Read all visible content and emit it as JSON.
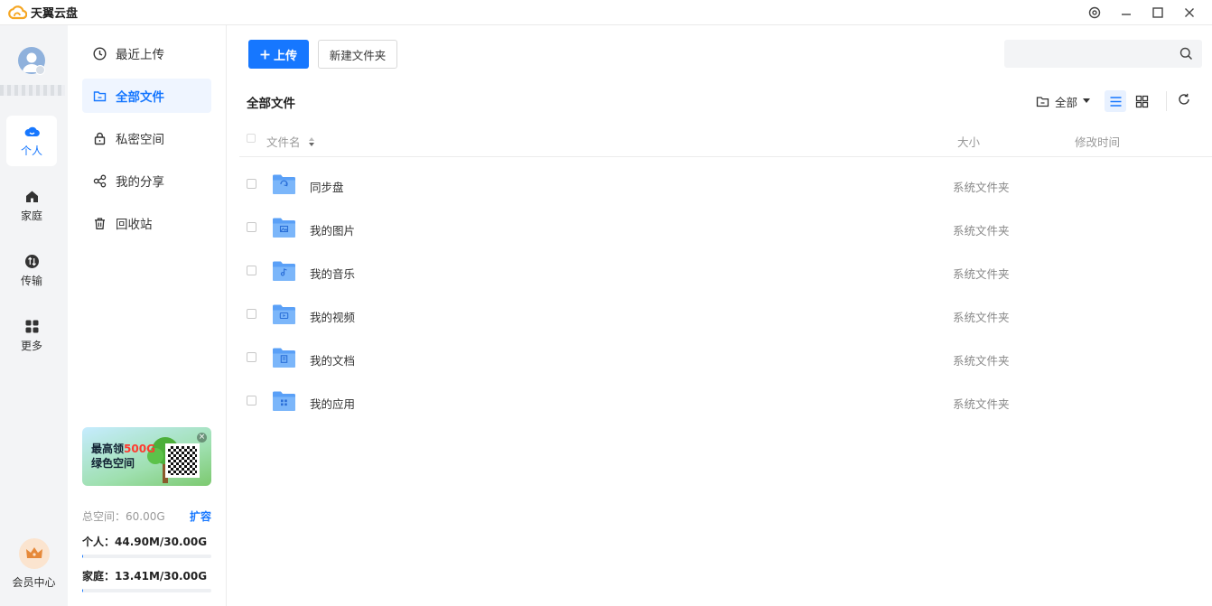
{
  "app": {
    "name": "天翼云盘"
  },
  "rail": {
    "items": [
      {
        "label": "个人",
        "icon": "cloud-icon",
        "active": true
      },
      {
        "label": "家庭",
        "icon": "home-icon",
        "active": false
      },
      {
        "label": "传输",
        "icon": "transfer-icon",
        "active": false
      },
      {
        "label": "更多",
        "icon": "grid-icon",
        "active": false
      }
    ],
    "vip_label": "会员中心"
  },
  "nav": {
    "items": [
      {
        "label": "最近上传",
        "icon": "clock-icon"
      },
      {
        "label": "全部文件",
        "icon": "folder-icon"
      },
      {
        "label": "私密空间",
        "icon": "lock-icon"
      },
      {
        "label": "我的分享",
        "icon": "share-icon"
      },
      {
        "label": "回收站",
        "icon": "trash-icon"
      }
    ],
    "promo": {
      "line1_prefix": "最高领",
      "line1_highlight": "500G",
      "line2": "绿色空间"
    },
    "space": {
      "total": "总空间：60.00G",
      "expand": "扩容",
      "personal": "个人：44.90M/30.00G",
      "personal_ratio": 0.0015,
      "family": "家庭：13.41M/30.00G",
      "family_ratio": 0.0004
    }
  },
  "toolbar": {
    "upload": "上传",
    "new_folder": "新建文件夹",
    "search_placeholder": ""
  },
  "main": {
    "title": "全部文件",
    "filter_label": "全部",
    "columns": {
      "name": "文件名",
      "size": "大小",
      "modified": "修改时间"
    },
    "files": [
      {
        "name": "同步盘",
        "type": "系统文件夹",
        "icon": "sync-folder-icon"
      },
      {
        "name": "我的图片",
        "type": "系统文件夹",
        "icon": "image-folder-icon"
      },
      {
        "name": "我的音乐",
        "type": "系统文件夹",
        "icon": "music-folder-icon"
      },
      {
        "name": "我的视频",
        "type": "系统文件夹",
        "icon": "video-folder-icon"
      },
      {
        "name": "我的文档",
        "type": "系统文件夹",
        "icon": "document-folder-icon"
      },
      {
        "name": "我的应用",
        "type": "系统文件夹",
        "icon": "app-folder-icon"
      }
    ]
  },
  "colors": {
    "accent": "#1677ff",
    "rail_bg": "#f3f4f6",
    "folder": "#5aa0f7"
  }
}
